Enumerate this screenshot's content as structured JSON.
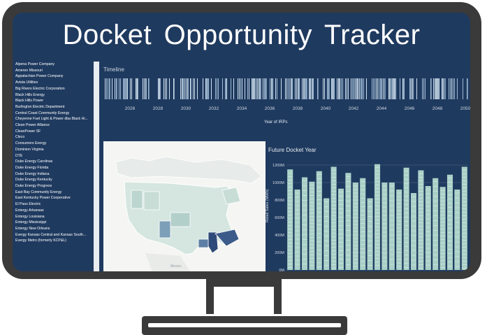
{
  "header": {
    "title": "Docket  Opportunity Tracker"
  },
  "sidebar": {
    "utilities": [
      "Alpena Power Company",
      "Ameren Missouri",
      "Appalachian Power Company",
      "Avista Utilities",
      "Big Rivers Electric Corporation",
      "Black Hills Energy",
      "Black Hills Power",
      "Burlington Electric Department",
      "Central Coast Community Energy",
      "Cheyenne Fuel Light & Power dba Black Hi...",
      "Clean Power Alliance",
      "CleanPower SF",
      "Cleco",
      "Consumers Energy",
      "Dominion Virginia",
      "DTE",
      "Duke Energy Carolinas",
      "Duke Energy Florida",
      "Duke Energy Indiana",
      "Duke Energy Kentucky",
      "Duke Energy Progress",
      "East Bay Community Energy",
      "East Kentucky Power Cooperative",
      "El Paso Electric",
      "Entergy Arkansas",
      "Entergy Louisiana",
      "Entergy Mississippi",
      "Entergy New Orleans",
      "Evergy Kansas Central and Kansas South...",
      "Evergy Metro (formerly KCP&L)"
    ]
  },
  "timeline": {
    "label": "Timeline",
    "axis_title": "Year of IRPs",
    "years": [
      "2026",
      "2028",
      "2030",
      "2032",
      "2034",
      "2036",
      "2038",
      "2040",
      "2042",
      "2044",
      "2046",
      "2048",
      "2050"
    ]
  },
  "map": {
    "caption": "Mexico",
    "highlight_color": "#2e4a78",
    "base_color": "#d5e6e0"
  },
  "chart_data": {
    "type": "bar",
    "title": "Future Docket Year",
    "xlabel": "",
    "ylabel": "Retail Sales (MWh)",
    "ylim": [
      0,
      1200
    ],
    "yticks": [
      "0M",
      "200M",
      "400M",
      "600M",
      "800M",
      "1000M",
      "1200M"
    ],
    "categories": [
      "",
      "",
      "",
      "",
      "",
      "",
      "",
      "",
      "",
      "",
      "",
      "",
      "",
      "",
      "",
      "",
      "",
      "",
      "",
      "",
      "",
      "",
      "",
      "",
      ""
    ],
    "values": [
      1150,
      920,
      1060,
      1010,
      1130,
      820,
      1180,
      930,
      1110,
      1000,
      1050,
      820,
      1210,
      1000,
      1000,
      920,
      1170,
      880,
      1140,
      960,
      1050,
      950,
      1090,
      920,
      1180
    ],
    "bar_color": "#a9d0c7",
    "grid": true
  }
}
